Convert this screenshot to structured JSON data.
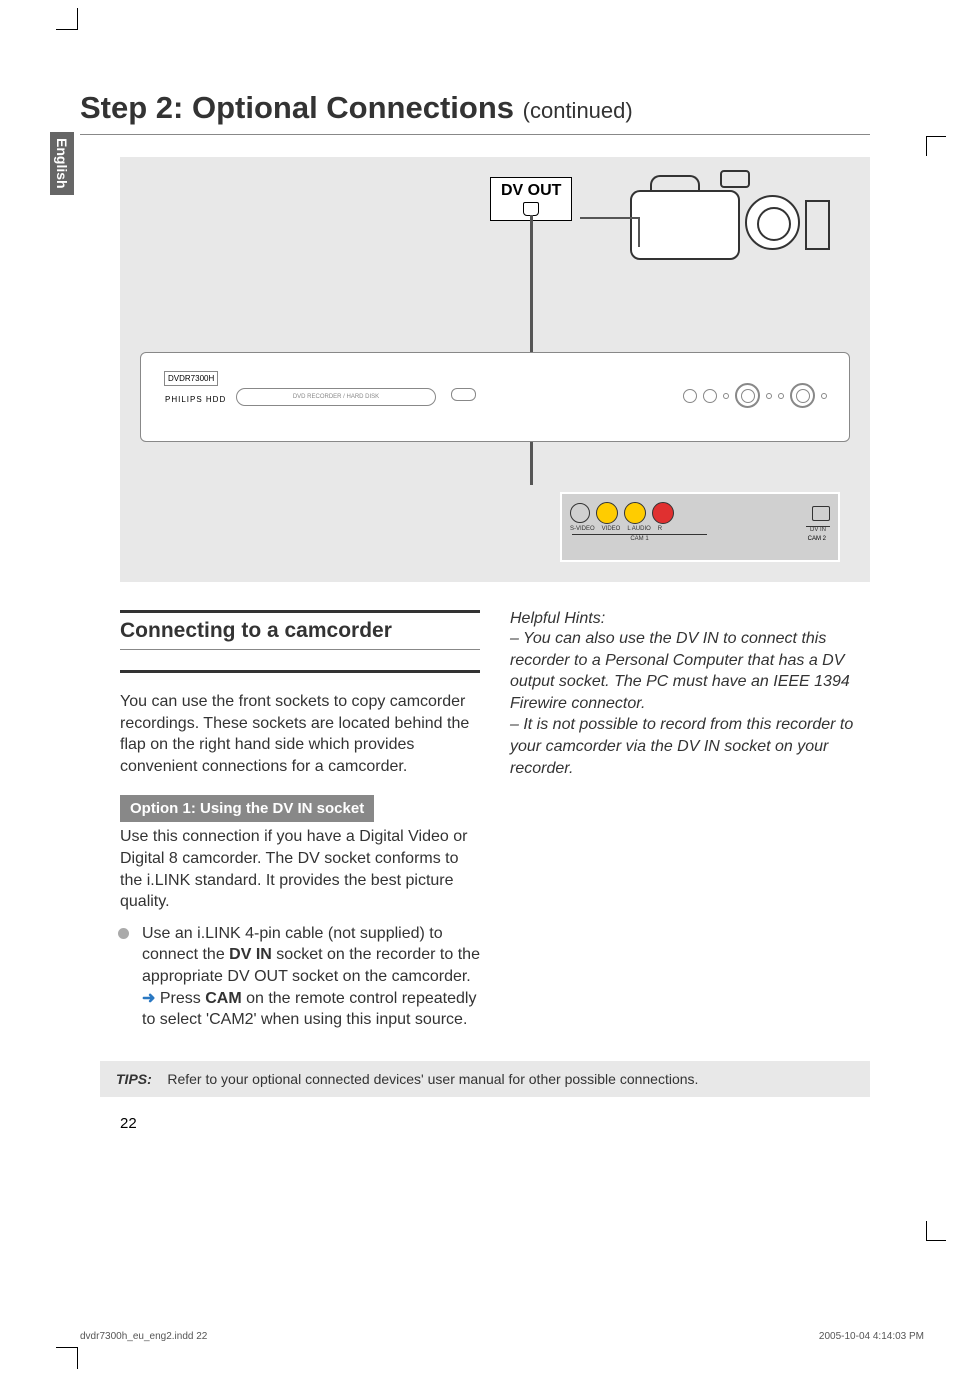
{
  "page_title_main": "Step 2: Optional Connections ",
  "page_title_sub": "(continued)",
  "sidebar_language": "English",
  "diagram": {
    "dvout_label": "DV OUT",
    "brand_text": "DVDR7300H",
    "brand_logo": "PHILIPS HDD",
    "tray_label": "DVD RECORDER / HARD DISK",
    "front_panel_labels": {
      "svideo": "S-VIDEO",
      "video": "VIDEO",
      "audio_l": "L  AUDIO",
      "audio_r": "R",
      "cam1": "CAM 1",
      "dvin": "DV IN",
      "cam2": "CAM 2"
    }
  },
  "section_heading": "Connecting to a camcorder",
  "intro_text": "You can use the front sockets to copy camcorder recordings. These sockets are located behind the flap on the right hand side which provides convenient connections for a camcorder.",
  "option_banner": "Option 1: Using the DV IN socket",
  "option_intro": "Use this connection if you have a Digital Video or Digital 8 camcorder. The DV socket conforms to the i.LINK standard. It provides the best picture quality.",
  "bullet_pre": "Use an i.LINK 4-pin cable (not supplied) to connect the ",
  "bullet_bold": "DV IN",
  "bullet_post": " socket on the recorder to the appropriate DV OUT socket on the camcorder.",
  "sub_arrow_pre": "Press ",
  "sub_arrow_bold": "CAM",
  "sub_arrow_post": " on the remote control repeatedly to select 'CAM2' when using this input source.",
  "hints_title": "Helpful Hints:",
  "hint1": "– You can also use the DV IN to connect this recorder to a Personal Computer that has a DV output socket. The PC must have an IEEE 1394 Firewire connector.",
  "hint2": "– It is not possible to record from this recorder to your camcorder via the DV IN socket on your recorder.",
  "tips_label": "TIPS:",
  "tips_text": "Refer to your optional connected devices' user manual for other possible connections.",
  "page_number": "22",
  "footer_left": "dvdr7300h_eu_eng2.indd   22",
  "footer_right": "2005-10-04   4:14:03 PM"
}
